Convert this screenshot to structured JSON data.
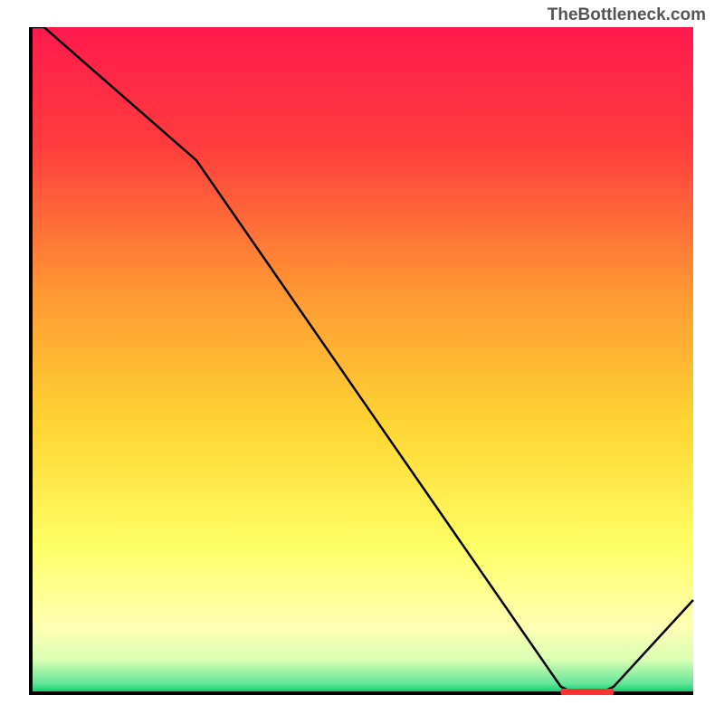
{
  "watermark": "TheBottleneck.com",
  "chart_data": {
    "type": "line",
    "title": "",
    "xlabel": "",
    "ylabel": "",
    "xlim": [
      0,
      100
    ],
    "ylim": [
      0,
      100
    ],
    "series": [
      {
        "name": "curve",
        "x": [
          0,
          2,
          25,
          80,
          82,
          86,
          88,
          100
        ],
        "values": [
          102,
          100,
          80,
          1,
          0,
          0,
          1,
          14
        ]
      }
    ],
    "optimal_marker": {
      "x_start": 80,
      "x_end": 88,
      "y": 0
    },
    "gradient_stops": [
      {
        "offset": 0,
        "color": "#ff1a4d"
      },
      {
        "offset": 0.18,
        "color": "#ff3d3d"
      },
      {
        "offset": 0.4,
        "color": "#ff9933"
      },
      {
        "offset": 0.6,
        "color": "#ffd633"
      },
      {
        "offset": 0.78,
        "color": "#ffff66"
      },
      {
        "offset": 0.9,
        "color": "#ffffb3"
      },
      {
        "offset": 0.95,
        "color": "#d9ffb3"
      },
      {
        "offset": 0.985,
        "color": "#66e699"
      },
      {
        "offset": 1.0,
        "color": "#00cc66"
      }
    ],
    "axis_color": "#000000",
    "line_color": "#000000",
    "marker_color": "#ff3333"
  }
}
